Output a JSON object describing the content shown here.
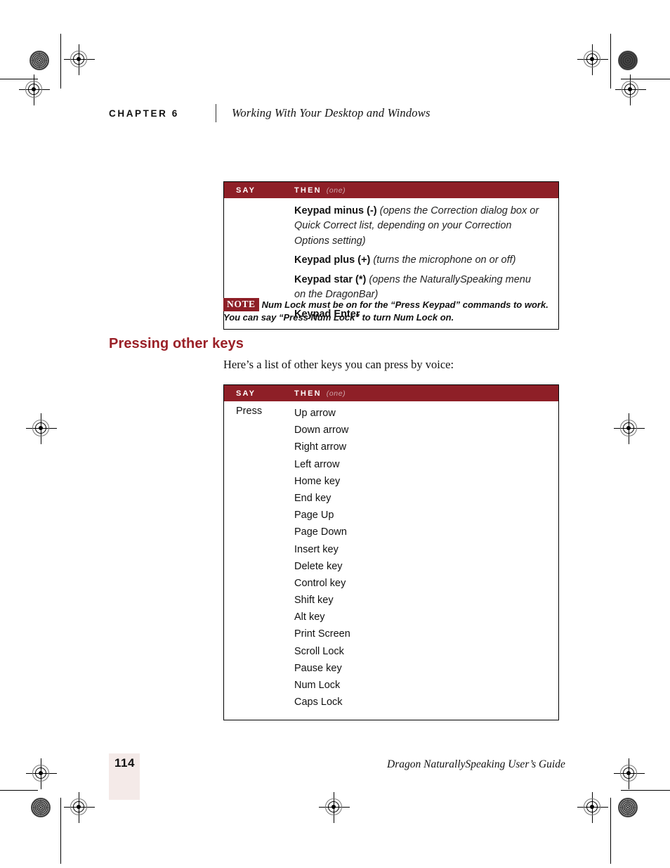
{
  "header": {
    "chapter_label": "CHAPTER 6",
    "chapter_title": "Working With Your Desktop and Windows"
  },
  "colors": {
    "accent_red": "#8e1f27",
    "heading_red": "#9a2027",
    "page_box": "#f4eae8",
    "header_text": "#ffffff"
  },
  "table_keypad": {
    "col_say": "SAY",
    "col_then": "THEN",
    "col_then_qualifier": "(one)",
    "rows": [
      {
        "say": "",
        "then_bold": "Keypad minus (-) ",
        "then_italic": "(opens the Correction dialog box or Quick Correct list, depending on your Correction Options setting)"
      },
      {
        "say": "",
        "then_bold": "Keypad plus (+) ",
        "then_italic": "(turns the microphone on or off)"
      },
      {
        "say": "",
        "then_bold": "Keypad star (*) ",
        "then_italic": "(opens the NaturallySpeaking menu on the DragonBar)"
      },
      {
        "say": "",
        "then_bold": "Keypad Enter",
        "then_italic": ""
      }
    ]
  },
  "note": {
    "badge": "NOTE",
    "text": "Num Lock must be on for the “Press Keypad” commands to work. You can say “Press Num Lock” to turn Num Lock on."
  },
  "section": {
    "heading": "Pressing other keys",
    "intro": "Here’s a list of other keys you can press by voice:"
  },
  "table_keys": {
    "col_say": "SAY",
    "col_then": "THEN",
    "col_then_qualifier": "(one)",
    "say_value": "Press",
    "keys": [
      "Up arrow",
      "Down arrow",
      "Right arrow",
      "Left arrow",
      "Home key",
      "End key",
      "Page Up",
      "Page Down",
      "Insert key",
      "Delete key",
      "Control key",
      "Shift key",
      "Alt key",
      "Print Screen",
      "Scroll Lock",
      "Pause key",
      "Num Lock",
      "Caps Lock"
    ]
  },
  "footer": {
    "page_number": "114",
    "guide_title": "Dragon NaturallySpeaking User’s Guide"
  }
}
